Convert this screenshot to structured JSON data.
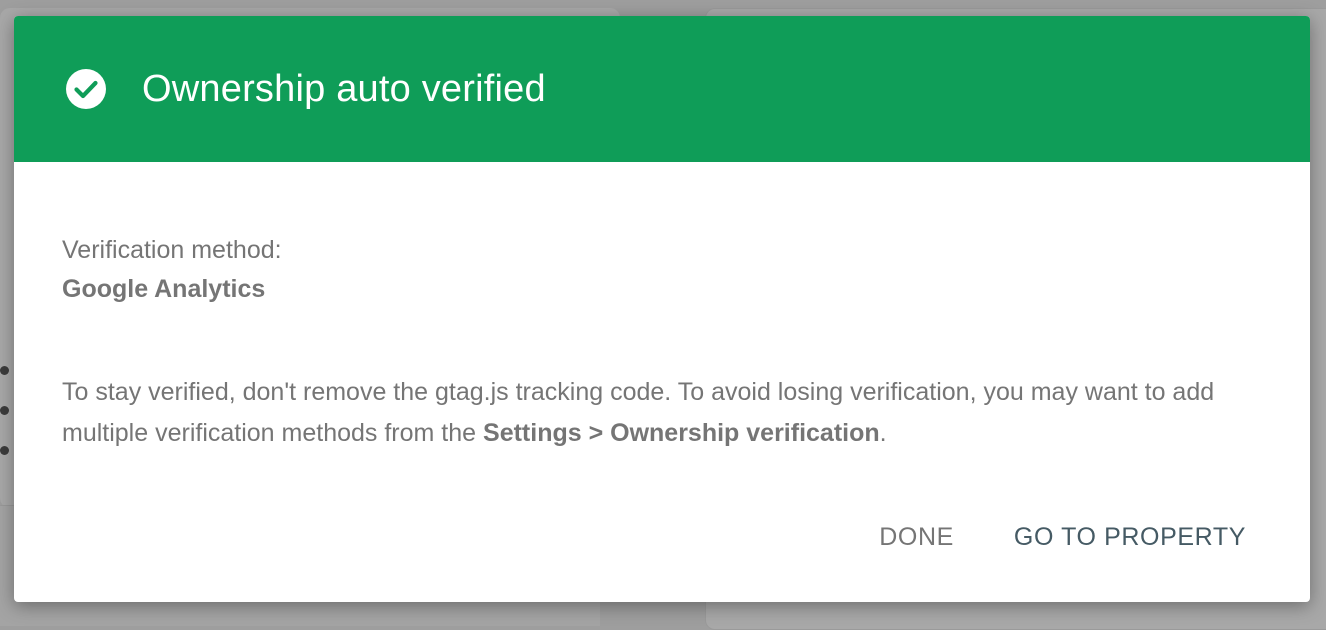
{
  "dialog": {
    "title": "Ownership auto verified",
    "header_color": "#0f9d58",
    "header_icon": "check-circle-icon",
    "method_label": "Verification method:",
    "method_value": "Google Analytics",
    "note_text": "To stay verified, don't remove the gtag.js tracking code. To avoid losing verification, you may want to add multiple verification methods from the ",
    "note_link_text": "Settings > Ownership verification",
    "note_end": ".",
    "buttons": {
      "done": "DONE",
      "go_to_property": "GO TO PROPERTY"
    }
  }
}
